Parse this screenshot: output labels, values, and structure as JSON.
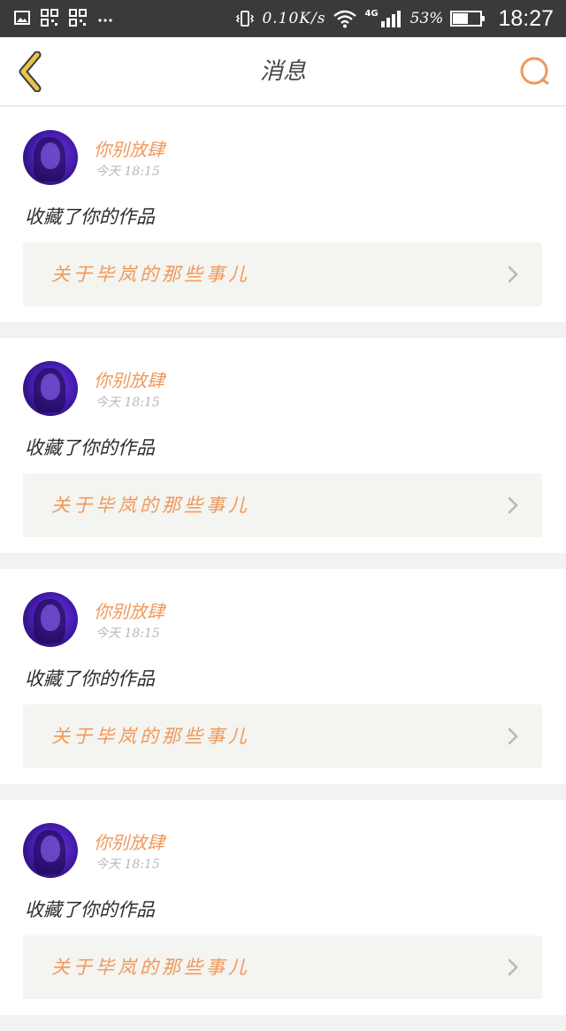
{
  "status_bar": {
    "net_speed": "0.10K/s",
    "network_type": "4G",
    "battery_percent": "53%",
    "time": "18:27",
    "icons": [
      "image-icon",
      "qr-icon",
      "qr-icon",
      "more-dots-icon",
      "vibrate-icon",
      "wifi-icon",
      "signal-icon",
      "battery-icon"
    ]
  },
  "header": {
    "title": "消息",
    "back_icon": "chevron-left-icon",
    "search_icon": "search-icon"
  },
  "colors": {
    "accent": "#f0985a",
    "back_arrow": "#e8b73a",
    "link_bg": "#f4f4f0"
  },
  "messages": [
    {
      "username": "你别放肆",
      "time": "今天 18:15",
      "action": "收藏了你的作品",
      "work_title": "关于毕岚的那些事儿"
    },
    {
      "username": "你别放肆",
      "time": "今天 18:15",
      "action": "收藏了你的作品",
      "work_title": "关于毕岚的那些事儿"
    },
    {
      "username": "你别放肆",
      "time": "今天 18:15",
      "action": "收藏了你的作品",
      "work_title": "关于毕岚的那些事儿"
    },
    {
      "username": "你别放肆",
      "time": "今天 18:15",
      "action": "收藏了你的作品",
      "work_title": "关于毕岚的那些事儿"
    }
  ]
}
